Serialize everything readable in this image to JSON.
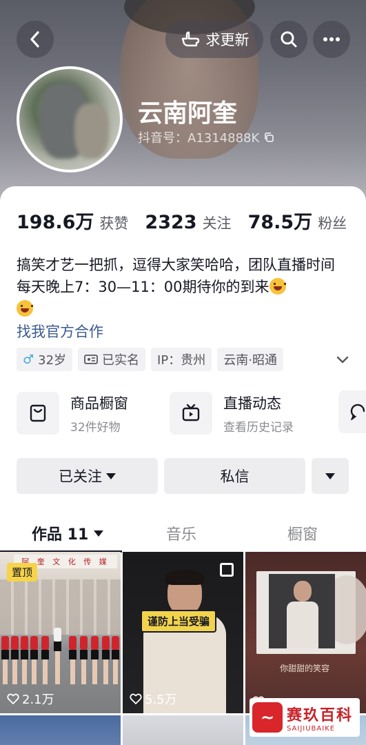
{
  "header": {
    "back_icon": "chevron-left-icon",
    "update_label": "求更新",
    "search_icon": "search-icon",
    "more_icon": "more-icon"
  },
  "profile": {
    "name": "云南阿奎",
    "douyin_id": "抖音号：A1314888K",
    "copy_icon": "copy-icon"
  },
  "stats": [
    {
      "value": "198.6万",
      "label": "获赞"
    },
    {
      "value": "2323",
      "label": "关注"
    },
    {
      "value": "78.5万",
      "label": "粉丝"
    }
  ],
  "bio": {
    "text": "搞笑才艺一把抓，逗得大家笑哈哈，团队直播时间每天晚上7：30—11：00期待你的到来",
    "link": "找我官方合作"
  },
  "tags": {
    "age": "32岁",
    "verified": "已实名",
    "ip": "IP：贵州",
    "location": "云南·昭通"
  },
  "services": [
    {
      "title": "商品橱窗",
      "subtitle": "32件好物",
      "icon": "shopping-bag-icon"
    },
    {
      "title": "直播动态",
      "subtitle": "查看历史记录",
      "icon": "tv-icon"
    }
  ],
  "actions": {
    "followed": "已关注",
    "message": "私信"
  },
  "tabs": [
    {
      "label": "作品 11",
      "active": true
    },
    {
      "label": "音乐",
      "active": false
    },
    {
      "label": "橱窗",
      "active": false
    }
  ],
  "videos": [
    {
      "pinned": "置顶",
      "likes": "2.1万",
      "banner_text": "阿 奎 文 化 传 媒"
    },
    {
      "likes": "5.5万",
      "caption": "谨防上当受骗"
    },
    {
      "likes": "",
      "cover_text": "你甜甜的笑容"
    }
  ],
  "watermark": {
    "zh": "赛玖百科",
    "en": "SAIJIUBAIKE"
  },
  "colors": {
    "link": "#3a5b8f",
    "pin_badge": "#f6d34a",
    "male_icon": "#3fa9d6"
  }
}
